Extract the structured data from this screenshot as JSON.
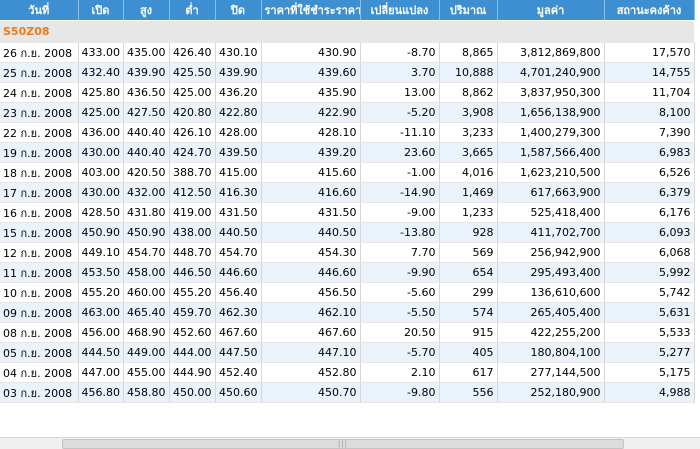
{
  "table": {
    "headers": [
      "วันที่",
      "เปิด",
      "สูง",
      "ต่ำ",
      "ปิด",
      "ราคาที่ใช้ชำระราคา",
      "เปลี่ยนแปลง",
      "ปริมาณ",
      "มูลค่า",
      "สถานะคงค้าง"
    ],
    "symbol": "S50Z08",
    "rows": [
      [
        "26 ก.ย. 2008",
        "433.00",
        "435.00",
        "426.40",
        "430.10",
        "430.90",
        "-8.70",
        "8,865",
        "3,812,869,800",
        "17,570"
      ],
      [
        "25 ก.ย. 2008",
        "432.40",
        "439.90",
        "425.50",
        "439.90",
        "439.60",
        "3.70",
        "10,888",
        "4,701,240,900",
        "14,755"
      ],
      [
        "24 ก.ย. 2008",
        "425.80",
        "436.50",
        "425.00",
        "436.20",
        "435.90",
        "13.00",
        "8,862",
        "3,837,950,300",
        "11,704"
      ],
      [
        "23 ก.ย. 2008",
        "425.00",
        "427.50",
        "420.80",
        "422.80",
        "422.90",
        "-5.20",
        "3,908",
        "1,656,138,900",
        "8,100"
      ],
      [
        "22 ก.ย. 2008",
        "436.00",
        "440.40",
        "426.10",
        "428.00",
        "428.10",
        "-11.10",
        "3,233",
        "1,400,279,300",
        "7,390"
      ],
      [
        "19 ก.ย. 2008",
        "430.00",
        "440.40",
        "424.70",
        "439.50",
        "439.20",
        "23.60",
        "3,665",
        "1,587,566,400",
        "6,983"
      ],
      [
        "18 ก.ย. 2008",
        "403.00",
        "420.50",
        "388.70",
        "415.00",
        "415.60",
        "-1.00",
        "4,016",
        "1,623,210,500",
        "6,526"
      ],
      [
        "17 ก.ย. 2008",
        "430.00",
        "432.00",
        "412.50",
        "416.30",
        "416.60",
        "-14.90",
        "1,469",
        "617,663,900",
        "6,379"
      ],
      [
        "16 ก.ย. 2008",
        "428.50",
        "431.80",
        "419.00",
        "431.50",
        "431.50",
        "-9.00",
        "1,233",
        "525,418,400",
        "6,176"
      ],
      [
        "15 ก.ย. 2008",
        "450.90",
        "450.90",
        "438.00",
        "440.50",
        "440.50",
        "-13.80",
        "928",
        "411,702,700",
        "6,093"
      ],
      [
        "12 ก.ย. 2008",
        "449.10",
        "454.70",
        "448.70",
        "454.70",
        "454.30",
        "7.70",
        "569",
        "256,942,900",
        "6,068"
      ],
      [
        "11 ก.ย. 2008",
        "453.50",
        "458.00",
        "446.50",
        "446.60",
        "446.60",
        "-9.90",
        "654",
        "295,493,400",
        "5,992"
      ],
      [
        "10 ก.ย. 2008",
        "455.20",
        "460.00",
        "455.20",
        "456.40",
        "456.50",
        "-5.60",
        "299",
        "136,610,600",
        "5,742"
      ],
      [
        "09 ก.ย. 2008",
        "463.00",
        "465.40",
        "459.70",
        "462.30",
        "462.10",
        "-5.50",
        "574",
        "265,405,400",
        "5,631"
      ],
      [
        "08 ก.ย. 2008",
        "456.00",
        "468.90",
        "452.60",
        "467.60",
        "467.60",
        "20.50",
        "915",
        "422,255,200",
        "5,533"
      ],
      [
        "05 ก.ย. 2008",
        "444.50",
        "449.00",
        "444.00",
        "447.50",
        "447.10",
        "-5.70",
        "405",
        "180,804,100",
        "5,277"
      ],
      [
        "04 ก.ย. 2008",
        "447.00",
        "455.00",
        "444.90",
        "452.40",
        "452.80",
        "2.10",
        "617",
        "277,144,500",
        "5,175"
      ],
      [
        "03 ก.ย. 2008",
        "456.80",
        "458.80",
        "450.00",
        "450.60",
        "450.70",
        "-9.80",
        "556",
        "252,180,900",
        "4,988"
      ]
    ]
  },
  "colors": {
    "header_bg": "#3d8fd1",
    "symbol_text": "#ee7a1c",
    "row_alt_bg": "#eaf3fb"
  },
  "scrollbar": {
    "grip": "|||"
  }
}
